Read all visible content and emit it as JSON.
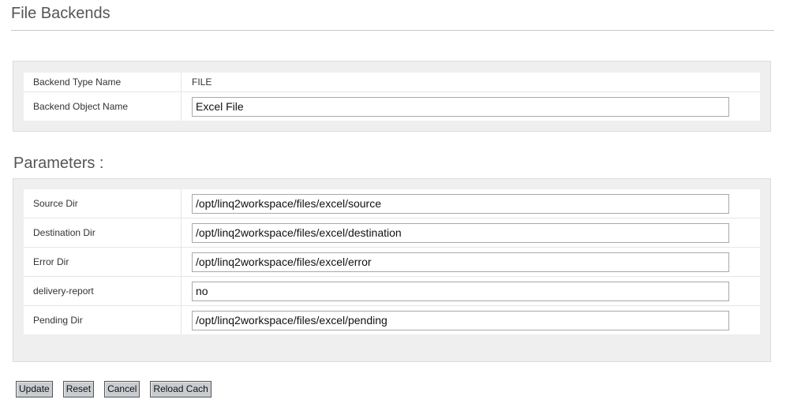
{
  "header": {
    "title": "File Backends"
  },
  "backend": {
    "rows": [
      {
        "label": "Backend Type Name",
        "value": "FILE",
        "editable": false
      },
      {
        "label": "Backend Object Name",
        "value": "Excel File",
        "editable": true
      }
    ]
  },
  "parameters": {
    "heading": "Parameters :",
    "rows": [
      {
        "label": "Source Dir",
        "value": "/opt/linq2workspace/files/excel/source"
      },
      {
        "label": "Destination Dir",
        "value": "/opt/linq2workspace/files/excel/destination"
      },
      {
        "label": "Error Dir",
        "value": "/opt/linq2workspace/files/excel/error"
      },
      {
        "label": "delivery-report",
        "value": "no"
      },
      {
        "label": "Pending Dir",
        "value": "/opt/linq2workspace/files/excel/pending"
      }
    ]
  },
  "actions": {
    "update_label": "Update",
    "reset_label": "Reset",
    "cancel_label": "Cancel",
    "reload_label": "Reload Cach"
  }
}
